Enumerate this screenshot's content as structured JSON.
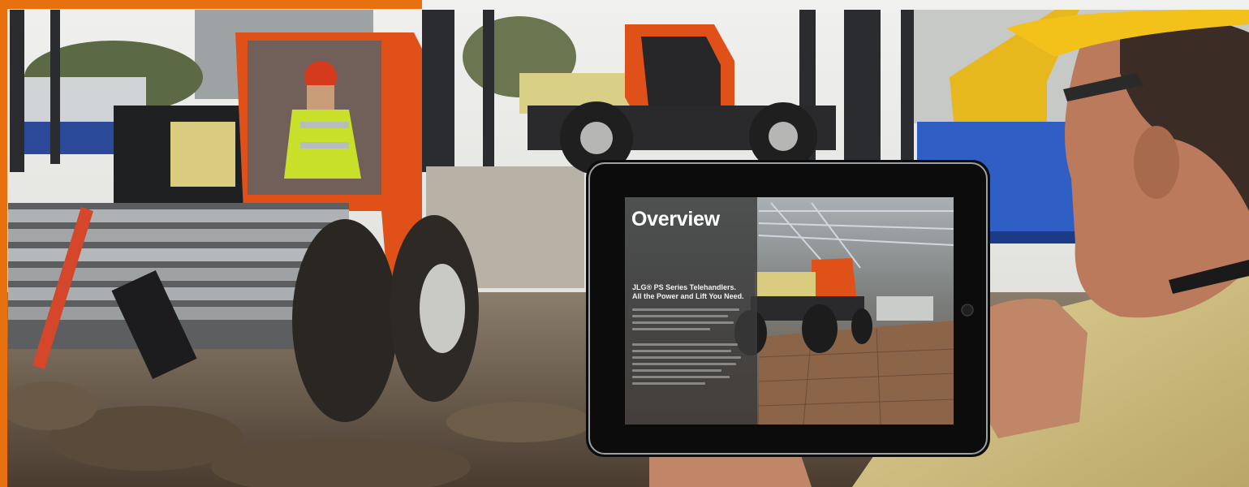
{
  "screen": {
    "title": "Overview",
    "heading": "JLG® PS Series Telehandlers. All the Power and Lift You Need."
  },
  "colors": {
    "accent_frame": "#e8700f",
    "machine_orange": "#e0511a",
    "hard_hat": "#f2c21a",
    "jacket": "#d7c585"
  },
  "icons": [
    "tablet-device",
    "telehandler",
    "operator",
    "worker-hard-hat"
  ]
}
